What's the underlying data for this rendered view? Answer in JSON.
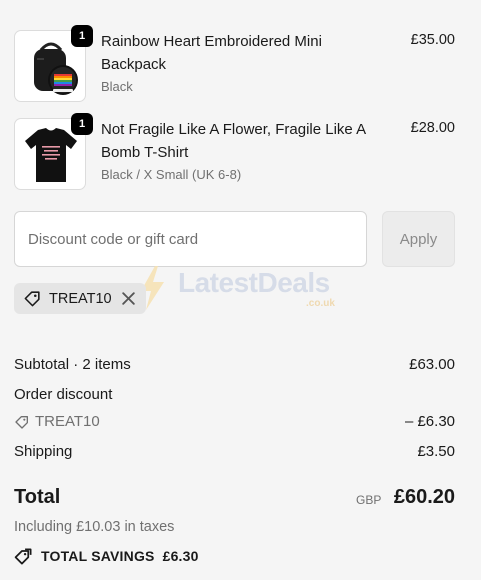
{
  "items": [
    {
      "quantity": "1",
      "title": "Rainbow Heart Embroidered Mini Backpack",
      "variant": "Black",
      "price": "£35.00"
    },
    {
      "quantity": "1",
      "title": "Not Fragile Like A Flower, Fragile Like A Bomb T-Shirt",
      "variant": "Black / X Small (UK 6-8)",
      "price": "£28.00"
    }
  ],
  "discount": {
    "placeholder": "Discount code or gift card",
    "apply_label": "Apply",
    "applied_code": "TREAT10"
  },
  "watermark": {
    "name": "LatestDeals",
    "domain": ".co.uk"
  },
  "summary": {
    "subtotal_label": "Subtotal · 2 items",
    "subtotal_value": "£63.00",
    "order_discount_label": "Order discount",
    "discount_code": "TREAT10",
    "discount_value": "– £6.30",
    "shipping_label": "Shipping",
    "shipping_value": "£3.50",
    "total_label": "Total",
    "currency": "GBP",
    "total_value": "£60.20",
    "taxes_note": "Including £10.03 in taxes",
    "savings_label": "TOTAL SAVINGS",
    "savings_value": "£6.30"
  },
  "colors": {
    "background": "#f5f5f5",
    "text": "#1a1a1a",
    "muted": "#707070",
    "badge": "#000000",
    "chip": "#e5e5e5"
  },
  "icons": [
    "tag-icon",
    "close-icon",
    "tag-outline-icon",
    "savings-tag-icon",
    "lightning-bolt-icon"
  ]
}
